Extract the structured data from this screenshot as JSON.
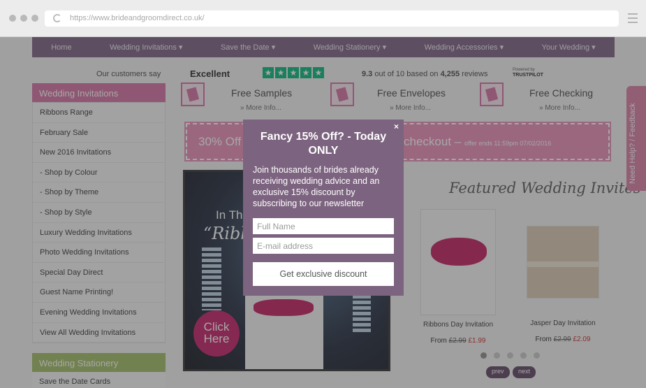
{
  "browser": {
    "url": "https://www.brideandgroomdirect.co.uk/"
  },
  "nav": {
    "items": [
      "Home",
      "Wedding Invitations ▾",
      "Save the Date ▾",
      "Wedding Stationery ▾",
      "Wedding Accessories ▾",
      "Your Wedding ▾"
    ]
  },
  "trustpilot": {
    "customers_say": "Our customers say",
    "rating_word": "Excellent",
    "score": "9.3",
    "score_text": "out of 10 based on",
    "reviews_count": "4,255",
    "reviews_word": "reviews",
    "powered_by": "Powered by",
    "brand": "TRUSTPILOT"
  },
  "sidebar": {
    "header": "Wedding Invitations",
    "items": [
      "Ribbons Range",
      "February Sale",
      "New 2016 Invitations",
      "- Shop by Colour",
      "- Shop by Theme",
      "- Shop by Style",
      "Luxury Wedding Invitations",
      "Photo Wedding Invitations",
      "Special Day Direct",
      "Guest Name Printing!",
      "Evening Wedding Invitations",
      "View All Wedding Invitations"
    ],
    "header2": "Wedding Stationery",
    "items2": [
      "Save the Date Cards"
    ]
  },
  "free_options": [
    {
      "title": "Free Samples",
      "more": "» More Info..."
    },
    {
      "title": "Free Envelopes",
      "more": "» More Info..."
    },
    {
      "title": "Free Checking",
      "more": "» More Info..."
    }
  ],
  "promo": {
    "left": "30% Off S",
    "right": "checkout",
    "dash": "–",
    "small": "offer ends 11:59pm 07/02/2016"
  },
  "hero": {
    "line1": "In The",
    "line2": "“Ribbon",
    "cta": "Click Here"
  },
  "featured": {
    "title": "Featured Wedding Invites",
    "products": [
      {
        "name": "Ribbons Day Invitation",
        "from": "From",
        "old_price": "£2.99",
        "new_price": "£1.99"
      },
      {
        "name": "Jasper Day Invitation",
        "from": "From",
        "old_price": "£2.99",
        "new_price": "£2.09"
      }
    ],
    "prev": "prev",
    "next": "next"
  },
  "feedback": "Need Help? / Feedback",
  "popup": {
    "close": "×",
    "title": "Fancy 15% Off? - Today ONLY",
    "body": "Join thousands of brides already receiving wedding advice and an exclusive 15% discount by subscribing to our newsletter",
    "name_placeholder": "Full Name",
    "email_placeholder": "E-mail address",
    "button": "Get exclusive discount"
  },
  "colors": {
    "nav": "#7a5e80",
    "pink": "#d46ea1",
    "green": "#9dbb5f",
    "popup": "#7c637f",
    "trustpilot_green": "#00b67a"
  }
}
